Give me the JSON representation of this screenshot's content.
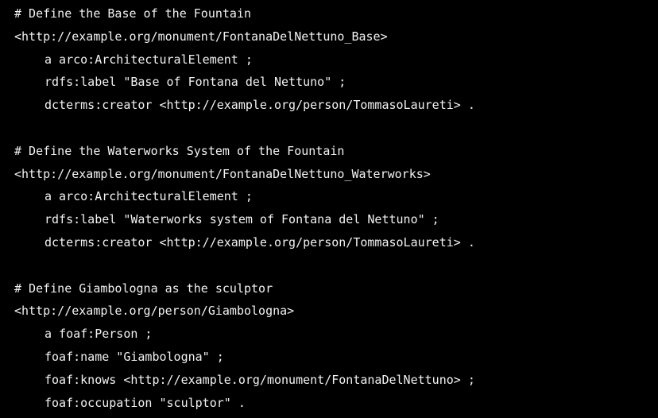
{
  "code_block": {
    "lines": [
      {
        "text": "# Define the Base of the Fountain",
        "indent": 0
      },
      {
        "text": "<http://example.org/monument/FontanaDelNettuno_Base>",
        "indent": 0
      },
      {
        "text": "a arco:ArchitecturalElement ;",
        "indent": 1
      },
      {
        "text": "rdfs:label \"Base of Fontana del Nettuno\" ;",
        "indent": 1
      },
      {
        "text": "dcterms:creator <http://example.org/person/TommasoLaureti> .",
        "indent": 1
      },
      {
        "text": "",
        "indent": 0
      },
      {
        "text": "# Define the Waterworks System of the Fountain",
        "indent": 0
      },
      {
        "text": "<http://example.org/monument/FontanaDelNettuno_Waterworks>",
        "indent": 0
      },
      {
        "text": "a arco:ArchitecturalElement ;",
        "indent": 1
      },
      {
        "text": "rdfs:label \"Waterworks system of Fontana del Nettuno\" ;",
        "indent": 1
      },
      {
        "text": "dcterms:creator <http://example.org/person/TommasoLaureti> .",
        "indent": 1
      },
      {
        "text": "",
        "indent": 0
      },
      {
        "text": "# Define Giambologna as the sculptor",
        "indent": 0
      },
      {
        "text": "<http://example.org/person/Giambologna>",
        "indent": 0
      },
      {
        "text": "a foaf:Person ;",
        "indent": 1
      },
      {
        "text": "foaf:name \"Giambologna\" ;",
        "indent": 1
      },
      {
        "text": "foaf:knows <http://example.org/monument/FontanaDelNettuno> ;",
        "indent": 1
      },
      {
        "text": "foaf:occupation \"sculptor\" .",
        "indent": 1
      }
    ]
  }
}
